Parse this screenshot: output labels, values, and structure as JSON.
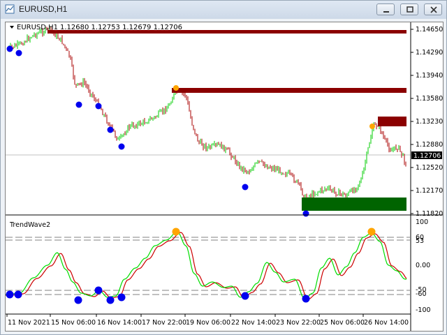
{
  "window": {
    "title": "EURUSD,H1",
    "buttons": [
      "minimize",
      "restore",
      "close"
    ]
  },
  "main_chart": {
    "header_symbol": "EURUSD,H1",
    "header_ohlc": "1.12680 1.12753 1.12679 1.12706",
    "current_price": "1.12706",
    "price_axis": [
      "1.14650",
      "1.14290",
      "1.13940",
      "1.13580",
      "1.13230",
      "1.12880",
      "1.12520",
      "1.12170",
      "1.11820"
    ],
    "candle_up_color": "#00cc00",
    "candle_down_color": "#aa0000",
    "resistance_color": "#8b0000",
    "support_color": "#006400",
    "marker_low_color": "#0000ee",
    "marker_high_color": "#ffa500"
  },
  "indicator": {
    "name": "TrendWave2",
    "axis": [
      "100",
      "60",
      "53",
      "0.00",
      "-50",
      "-60",
      "-100"
    ],
    "fast_line_color": "#00dd00",
    "slow_line_color": "#cc0000"
  },
  "time_axis": [
    "11 Nov 2021",
    "15 Nov 06:00",
    "16 Nov 14:00",
    "17 Nov 22:00",
    "19 Nov 06:00",
    "22 Nov 14:00",
    "23 Nov 22:00",
    "25 Nov 06:00",
    "26 Nov 14:00"
  ]
}
